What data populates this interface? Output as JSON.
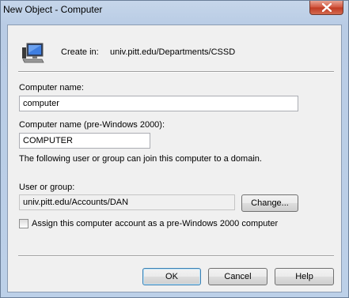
{
  "window": {
    "title": "New Object - Computer"
  },
  "header": {
    "create_in_label": "Create in:",
    "create_in_path": "univ.pitt.edu/Departments/CSSD"
  },
  "form": {
    "computer_name_label": "Computer name:",
    "computer_name_value": "computer",
    "pre2000_label": "Computer name (pre-Windows 2000):",
    "pre2000_value": "COMPUTER",
    "join_info": "The following user or group can join this computer to a domain.",
    "user_group_label": "User or group:",
    "user_group_value": "univ.pitt.edu/Accounts/DAN",
    "change_button": "Change...",
    "assign_checkbox_label": "Assign this computer account as a pre-Windows 2000 computer",
    "assign_checked": false
  },
  "footer": {
    "ok_label": "OK",
    "cancel_label": "Cancel",
    "help_label": "Help"
  },
  "icons": {
    "window_close": "close-icon",
    "object_type": "computer-icon"
  }
}
